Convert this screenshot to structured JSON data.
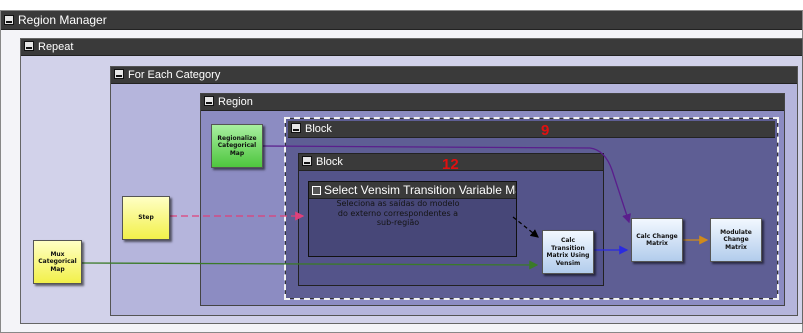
{
  "containers": {
    "region_manager": "Region Manager",
    "repeat": "Repeat",
    "for_each_category": "For Each Category",
    "region": "Region",
    "block_outer": "Block",
    "block_inner": "Block",
    "select_matrix": "Select Vensim Transition Variable Matrix"
  },
  "description": "Seleciona as saídas do modelo do externo correspondentes a sub-região",
  "annotations": {
    "outer_block_number": "9",
    "inner_block_number": "12"
  },
  "nodes": {
    "regionalize": "Regionalize Categorical Map",
    "step": "Step",
    "mux": "Mux Categorical Map",
    "calc_transition": "Calc Transition Matrix Using Vensim",
    "calc_change": "Calc Change Matrix",
    "modulate": "Modulate Change Matrix"
  },
  "colors": {
    "region_manager_bg": "#f4f4f8",
    "repeat_bg": "#d2d2ea",
    "for_each_bg": "#b5b5dc",
    "region_bg": "#8c8cc2",
    "block_outer_bg": "#5e5e94",
    "block_inner_bg": "#54548a",
    "select_bg": "#474778",
    "edge_pink": "#e0407a",
    "edge_green": "#3a7a28",
    "edge_purple": "#5a1e8c",
    "edge_blue": "#2a2ae0",
    "edge_orange": "#d08a1a",
    "edge_black": "#000000"
  }
}
